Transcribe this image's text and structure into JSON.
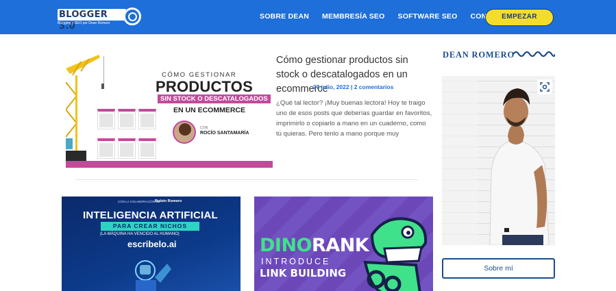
{
  "header": {
    "logo_text": "BLOGGER 3.0",
    "logo_tagline": "Blogging y SEO por Dean Romero",
    "nav": [
      "SOBRE DEAN",
      "MEMBRESÍA SEO",
      "SOFTWARE SEO",
      "CONTACTO"
    ],
    "cta_label": "EMPEZAR"
  },
  "featured": {
    "image_text": {
      "line1": "CÓMO GESTIONAR",
      "line2": "PRODUCTOS",
      "line3": "SIN STOCK O DESCATALOGADOS",
      "line4": "EN UN ECOMMERCE",
      "con": "CON",
      "author": "ROCÍO SANTAMARÍA"
    },
    "title": "Cómo gestionar productos sin stock o descatalogados en un ecommerce",
    "meta": "27 julio, 2022 | 2 comentarios",
    "excerpt": "¿Qué tal lector? ¡Muy buenas lectora! Hoy te traigo uno de esos posts que deberías guardar en favoritos, imprimirlo o copiarlo a mano en un cuaderno, como tú quieras. Pero tenlo a mano porque muy"
  },
  "cards": [
    {
      "top_note": "CON LA COLABORACIÓN DE",
      "brand": "Rubén Romero",
      "headline": "INTELIGENCIA ARTIFICIAL",
      "subline": "PARA CREAR NICHOS",
      "note": "(LA MÁQUINA HA VENCIDO AL HUMANO)",
      "brand2": "escribelo.ai"
    },
    {
      "word1": "DINO",
      "word2": "RANK",
      "intro": "INTRODUCE",
      "link": "LINK BUILDING"
    }
  ],
  "sidebar": {
    "title": "DEAN ROMERO",
    "button_label": "Sobre mí"
  },
  "colors": {
    "header_blue": "#1e6fd9",
    "cta_yellow": "#f4dd2a",
    "accent_navy": "#1a4b8c",
    "pink": "#c04b9b",
    "dino_green": "#3fe28a"
  },
  "icons": [
    "search-icon",
    "expand-icon"
  ]
}
